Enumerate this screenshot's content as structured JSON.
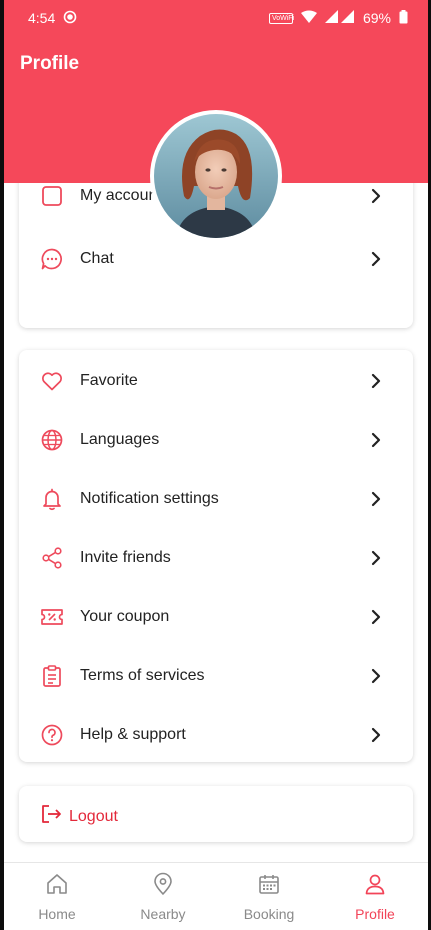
{
  "status_bar": {
    "time": "4:54",
    "battery": "69%",
    "wifi_badge": "VoWiFi"
  },
  "header": {
    "title": "Profile"
  },
  "account_card": {
    "items": [
      {
        "label": "My account",
        "icon": "account-icon"
      },
      {
        "label": "Chat",
        "icon": "chat-bubble-icon"
      }
    ]
  },
  "settings_card": {
    "items": [
      {
        "label": "Favorite",
        "icon": "heart-icon"
      },
      {
        "label": "Languages",
        "icon": "globe-icon"
      },
      {
        "label": "Notification settings",
        "icon": "bell-icon"
      },
      {
        "label": "Invite friends",
        "icon": "share-icon"
      },
      {
        "label": "Your coupon",
        "icon": "coupon-icon"
      },
      {
        "label": "Terms of services",
        "icon": "clipboard-icon"
      },
      {
        "label": "Help & support",
        "icon": "question-circle-icon"
      }
    ]
  },
  "logout": {
    "label": "Logout",
    "icon": "logout-icon"
  },
  "bottom_nav": {
    "items": [
      {
        "label": "Home",
        "icon": "home-icon"
      },
      {
        "label": "Nearby",
        "icon": "location-pin-icon"
      },
      {
        "label": "Booking",
        "icon": "calendar-icon"
      },
      {
        "label": "Profile",
        "icon": "user-icon",
        "active": true
      }
    ]
  },
  "colors": {
    "brand": "#f5485a",
    "active_nav": "#f24458",
    "logout": "#e3283a",
    "icon_tint": "#ee4a5c"
  }
}
